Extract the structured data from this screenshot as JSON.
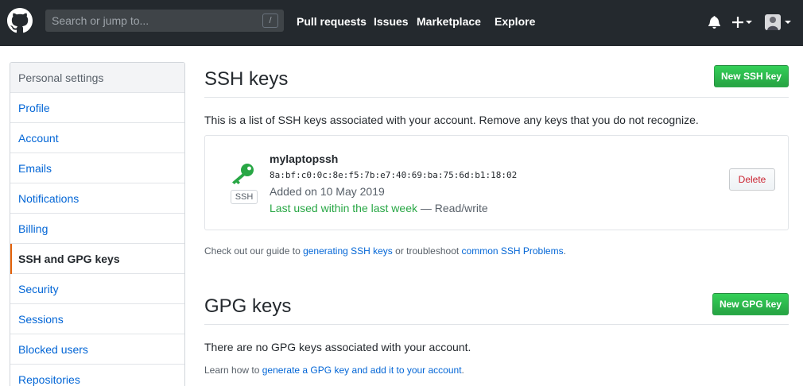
{
  "header": {
    "search_placeholder": "Search or jump to...",
    "search_key": "/",
    "nav": [
      "Pull requests",
      "Issues",
      "Marketplace",
      "Explore"
    ],
    "icons": [
      "github-logo",
      "bell-icon",
      "plus-icon",
      "avatar"
    ]
  },
  "sidebar": {
    "heading": "Personal settings",
    "items": [
      {
        "label": "Profile",
        "selected": false
      },
      {
        "label": "Account",
        "selected": false
      },
      {
        "label": "Emails",
        "selected": false
      },
      {
        "label": "Notifications",
        "selected": false
      },
      {
        "label": "Billing",
        "selected": false
      },
      {
        "label": "SSH and GPG keys",
        "selected": true
      },
      {
        "label": "Security",
        "selected": false
      },
      {
        "label": "Sessions",
        "selected": false
      },
      {
        "label": "Blocked users",
        "selected": false
      },
      {
        "label": "Repositories",
        "selected": false
      }
    ]
  },
  "ssh": {
    "title": "SSH keys",
    "new_button": "New SSH key",
    "description": "This is a list of SSH keys associated with your account. Remove any keys that you do not recognize.",
    "key": {
      "badge": "SSH",
      "name": "mylaptopssh",
      "fingerprint": "8a:bf:c0:0c:8e:f5:7b:e7:40:69:ba:75:6d:b1:18:02",
      "added": "Added on 10 May 2019",
      "last_used": "Last used within the last week",
      "access": "— Read/write",
      "delete_button": "Delete"
    },
    "guide": {
      "prefix": "Check out our guide to ",
      "link1": "generating SSH keys",
      "middle": " or troubleshoot ",
      "link2": "common SSH Problems",
      "suffix": "."
    }
  },
  "gpg": {
    "title": "GPG keys",
    "new_button": "New GPG key",
    "empty": "There are no GPG keys associated with your account.",
    "learn": {
      "prefix": "Learn how to ",
      "link": "generate a GPG key and add it to your account",
      "suffix": "."
    }
  },
  "colors": {
    "header_bg": "#24292e",
    "link": "#0366d6",
    "green": "#28a745",
    "danger": "#cb2431",
    "selected_accent": "#e36209"
  }
}
